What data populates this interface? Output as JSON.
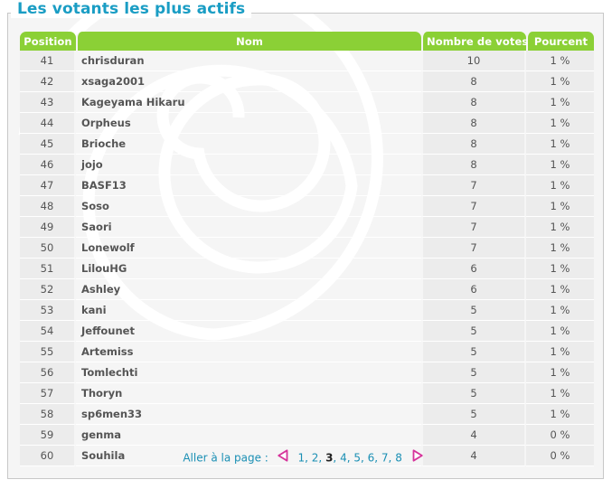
{
  "panel": {
    "title": "Les votants les plus actifs",
    "accent_green": "#8bd036",
    "accent_teal": "#1a8fb4",
    "accent_pink": "#d6339b"
  },
  "table": {
    "columns": [
      {
        "key": "position",
        "label": "Position"
      },
      {
        "key": "name",
        "label": "Nom"
      },
      {
        "key": "votes",
        "label": "Nombre de votes"
      },
      {
        "key": "percent",
        "label": "Pourcent"
      }
    ],
    "rows": [
      {
        "position": "41",
        "name": "chrisduran",
        "votes": "10",
        "percent": "1 %"
      },
      {
        "position": "42",
        "name": "xsaga2001",
        "votes": "8",
        "percent": "1 %"
      },
      {
        "position": "43",
        "name": "Kageyama Hikaru",
        "votes": "8",
        "percent": "1 %"
      },
      {
        "position": "44",
        "name": "Orpheus",
        "votes": "8",
        "percent": "1 %"
      },
      {
        "position": "45",
        "name": "Brioche",
        "votes": "8",
        "percent": "1 %"
      },
      {
        "position": "46",
        "name": "jojo",
        "votes": "8",
        "percent": "1 %"
      },
      {
        "position": "47",
        "name": "BASF13",
        "votes": "7",
        "percent": "1 %"
      },
      {
        "position": "48",
        "name": "Soso",
        "votes": "7",
        "percent": "1 %"
      },
      {
        "position": "49",
        "name": "Saori",
        "votes": "7",
        "percent": "1 %"
      },
      {
        "position": "50",
        "name": "Lonewolf",
        "votes": "7",
        "percent": "1 %"
      },
      {
        "position": "51",
        "name": "LilouHG",
        "votes": "6",
        "percent": "1 %"
      },
      {
        "position": "52",
        "name": "Ashley",
        "votes": "6",
        "percent": "1 %"
      },
      {
        "position": "53",
        "name": "kani",
        "votes": "5",
        "percent": "1 %"
      },
      {
        "position": "54",
        "name": "Jeffounet",
        "votes": "5",
        "percent": "1 %"
      },
      {
        "position": "55",
        "name": "Artemiss",
        "votes": "5",
        "percent": "1 %"
      },
      {
        "position": "56",
        "name": "Tomlechti",
        "votes": "5",
        "percent": "1 %"
      },
      {
        "position": "57",
        "name": "Thoryn",
        "votes": "5",
        "percent": "1 %"
      },
      {
        "position": "58",
        "name": "sp6men33",
        "votes": "5",
        "percent": "1 %"
      },
      {
        "position": "59",
        "name": "genma",
        "votes": "4",
        "percent": "0 %"
      },
      {
        "position": "60",
        "name": "Souhila",
        "votes": "4",
        "percent": "0 %"
      }
    ]
  },
  "pagination": {
    "label": "Aller à la page :",
    "prev_icon": "triangle-left-icon",
    "next_icon": "triangle-right-icon",
    "separator": ", ",
    "current": "3",
    "pages": [
      "1",
      "2",
      "3",
      "4",
      "5",
      "6",
      "7",
      "8"
    ]
  }
}
